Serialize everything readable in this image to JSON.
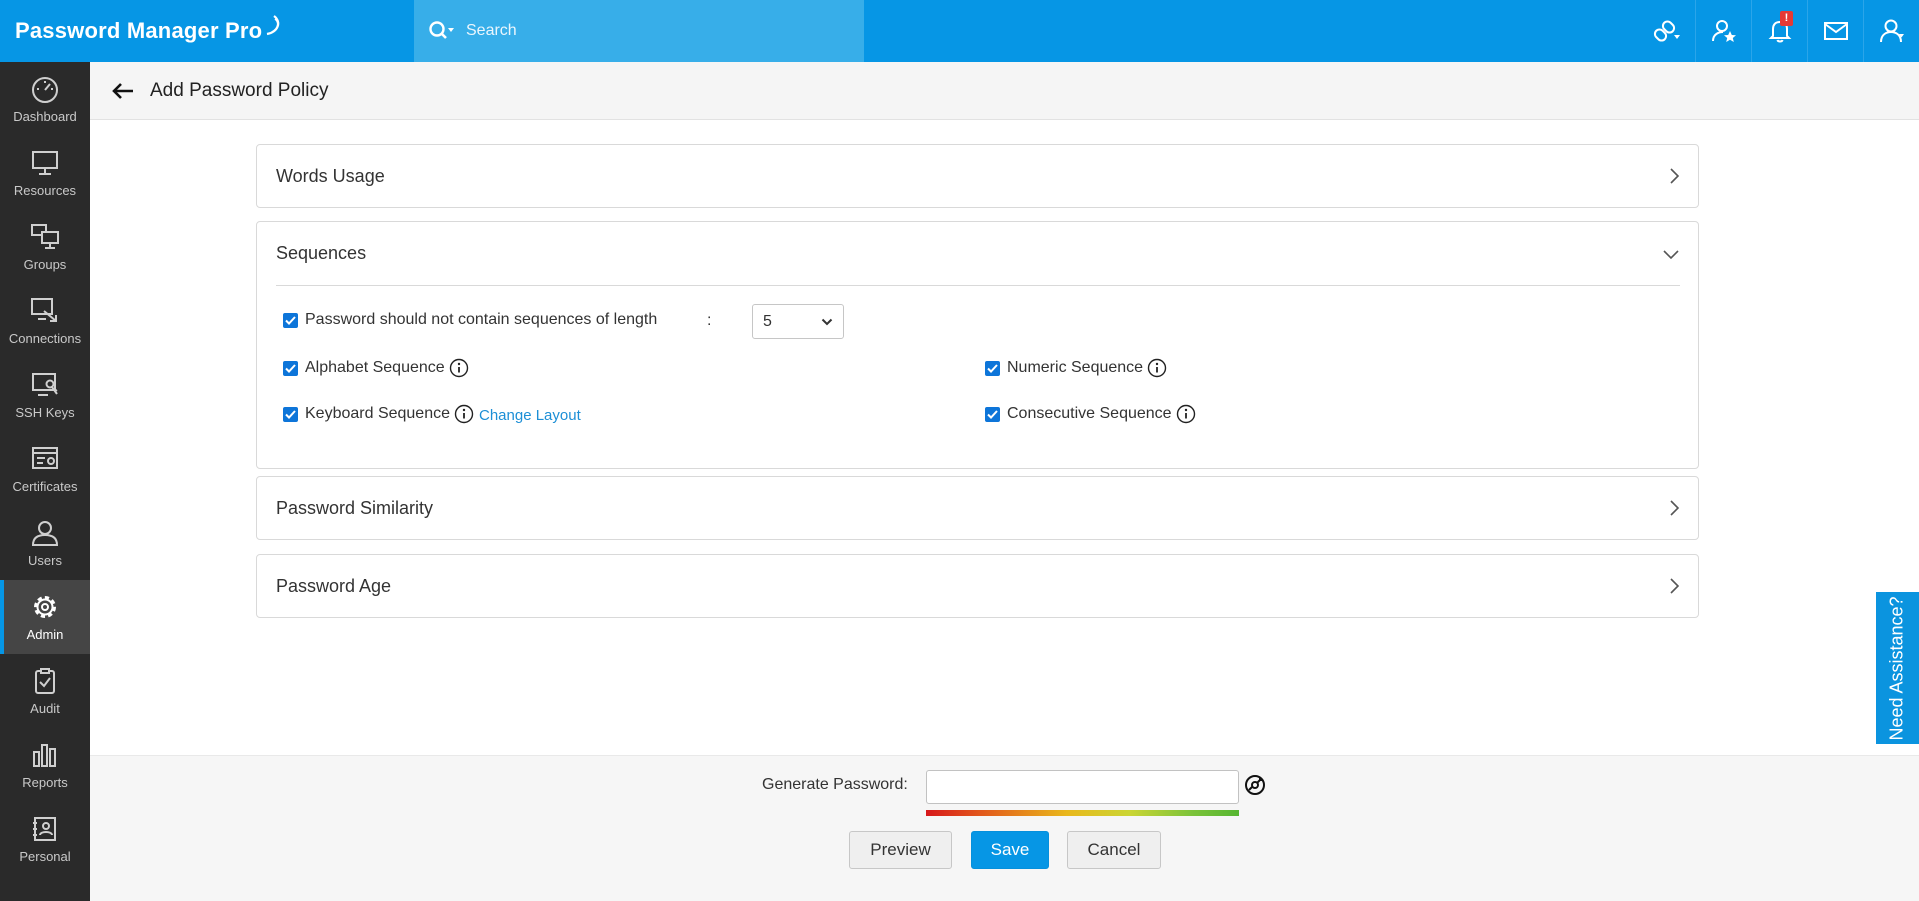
{
  "header": {
    "logo_text": "Password Manager Pro",
    "search_placeholder": "Search",
    "notification_count": "!"
  },
  "sidebar": {
    "items": [
      {
        "label": "Dashboard",
        "icon": "dashboard-icon"
      },
      {
        "label": "Resources",
        "icon": "monitor-icon"
      },
      {
        "label": "Groups",
        "icon": "groups-icon"
      },
      {
        "label": "Connections",
        "icon": "connections-icon"
      },
      {
        "label": "SSH Keys",
        "icon": "ssh-key-icon"
      },
      {
        "label": "Certificates",
        "icon": "certificate-icon"
      },
      {
        "label": "Users",
        "icon": "user-icon"
      },
      {
        "label": "Admin",
        "icon": "gear-icon",
        "active": true
      },
      {
        "label": "Audit",
        "icon": "clipboard-check-icon"
      },
      {
        "label": "Reports",
        "icon": "bar-chart-icon"
      },
      {
        "label": "Personal",
        "icon": "personal-icon"
      }
    ]
  },
  "page": {
    "title": "Add Password Policy"
  },
  "sections": {
    "words_usage": "Words Usage",
    "sequences": {
      "title": "Sequences",
      "main_option": "Password should not contain sequences of length",
      "colon": ":",
      "length_value": "5",
      "alphabet": "Alphabet Sequence",
      "numeric": "Numeric Sequence",
      "keyboard": "Keyboard Sequence",
      "change_layout": "Change Layout",
      "consecutive": "Consecutive Sequence"
    },
    "password_similarity": "Password Similarity",
    "password_age": "Password Age"
  },
  "footer": {
    "generate_label": "Generate Password:",
    "generate_value": "",
    "preview": "Preview",
    "save": "Save",
    "cancel": "Cancel"
  },
  "assist_label": "Need Assistance?",
  "colors": {
    "brand": "#0696e5",
    "sidebar": "#2a2a2a",
    "checkbox": "#0d75d9",
    "link": "#1d8fd6"
  }
}
